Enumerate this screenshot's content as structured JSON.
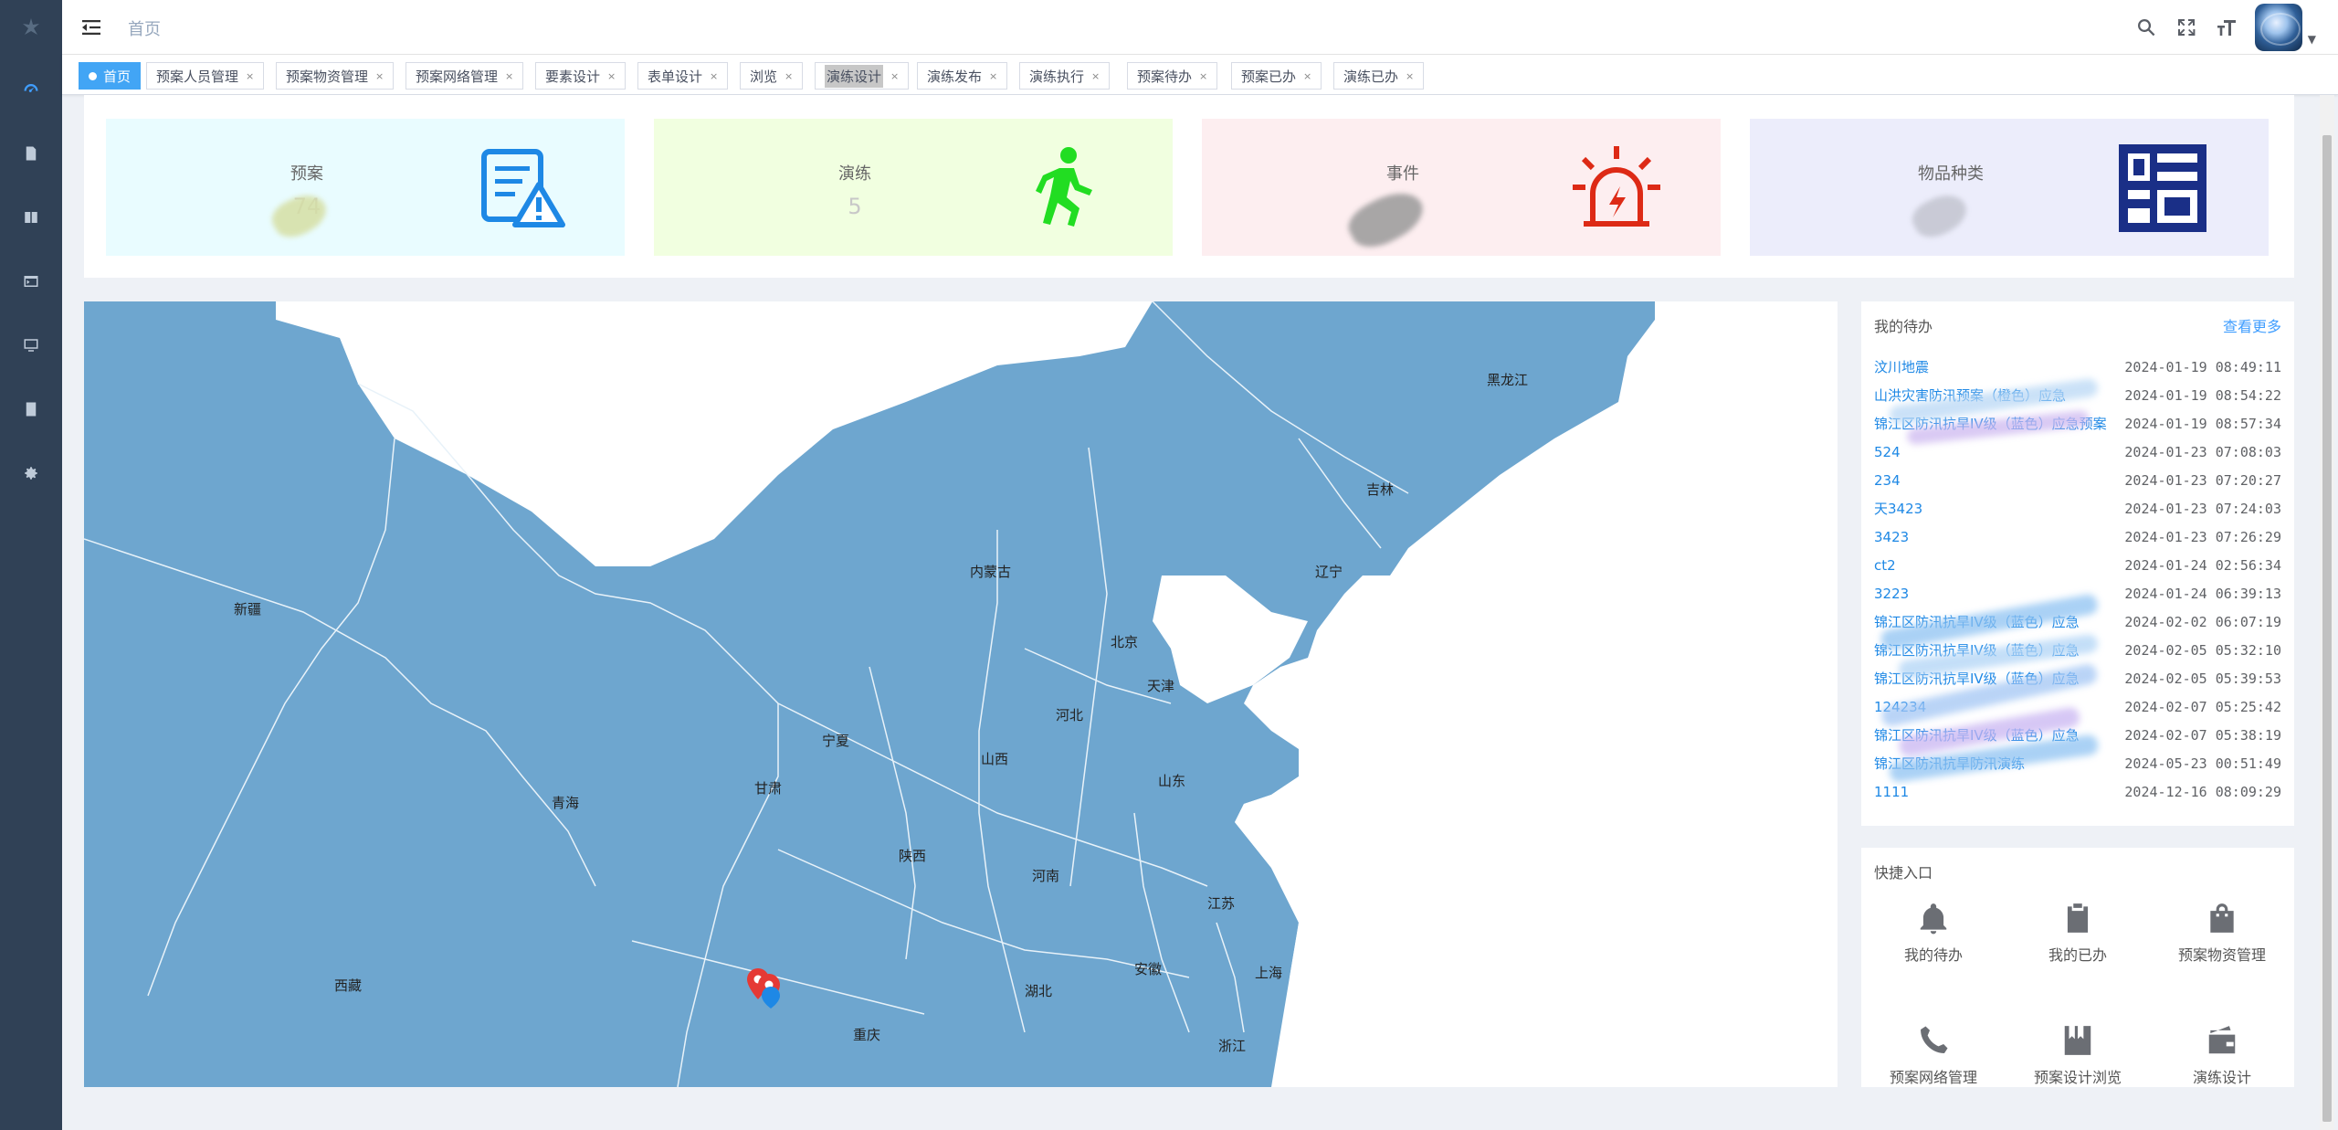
{
  "navbar": {
    "breadcrumb": "首页"
  },
  "tags": [
    {
      "label": "首页",
      "active": true
    },
    {
      "label": "预案人员管理"
    },
    {
      "label": "预案物资管理"
    },
    {
      "label": "预案网络管理"
    },
    {
      "label": "要素设计"
    },
    {
      "label": "表单设计"
    },
    {
      "label": "浏览"
    },
    {
      "label": "演练设计"
    },
    {
      "label": "演练发布"
    },
    {
      "label": "演练执行"
    },
    {
      "label": "预案待办"
    },
    {
      "label": "预案已办"
    },
    {
      "label": "演练已办"
    }
  ],
  "tag_close": "×",
  "stats": [
    {
      "title": "预案",
      "value": "74",
      "bg": "#e9fcff",
      "accent": "#1e88e5"
    },
    {
      "title": "演练",
      "value": "5",
      "bg": "#f1ffe0",
      "accent": "#22dd22"
    },
    {
      "title": "事件",
      "value": "",
      "bg": "#fdeef0",
      "accent": "#dd2a16"
    },
    {
      "title": "物品种类",
      "value": "",
      "bg": "#ecedfb",
      "accent": "#1a2f87"
    }
  ],
  "map": {
    "labels": [
      "黑龙江",
      "吉林",
      "辽宁",
      "内蒙古",
      "新疆",
      "北京",
      "天津",
      "河北",
      "山西",
      "宁夏",
      "甘肃",
      "青海",
      "山东",
      "陕西",
      "河南",
      "江苏",
      "安徽",
      "湖北",
      "西藏",
      "重庆",
      "上海",
      "浙江"
    ]
  },
  "todo": {
    "title": "我的待办",
    "more": "查看更多",
    "items": [
      {
        "name": "汶川地震",
        "time": "2024-01-19 08:49:11"
      },
      {
        "name": "山洪灾害防汛预案（橙色）应急",
        "time": "2024-01-19 08:54:22"
      },
      {
        "name": "锦江区防汛抗旱IV级（蓝色）应急预案",
        "time": "2024-01-19 08:57:34"
      },
      {
        "name": "524",
        "time": "2024-01-23 07:08:03"
      },
      {
        "name": "234",
        "time": "2024-01-23 07:20:27"
      },
      {
        "name": "天3423",
        "time": "2024-01-23 07:24:03"
      },
      {
        "name": "3423",
        "time": "2024-01-23 07:26:29"
      },
      {
        "name": "ct2",
        "time": "2024-01-24 02:56:34"
      },
      {
        "name": "3223",
        "time": "2024-01-24 06:39:13"
      },
      {
        "name": "锦江区防汛抗旱IV级（蓝色）应急",
        "time": "2024-02-02 06:07:19"
      },
      {
        "name": "锦江区防汛抗旱IV级（蓝色）应急",
        "time": "2024-02-05 05:32:10"
      },
      {
        "name": "锦江区防汛抗旱IV级（蓝色）应急",
        "time": "2024-02-05 05:39:53"
      },
      {
        "name": "124234",
        "time": "2024-02-07 05:25:42"
      },
      {
        "name": "锦江区防汛抗旱IV级（蓝色）应急",
        "time": "2024-02-07 05:38:19"
      },
      {
        "name": "锦江区防汛抗旱防汛演练",
        "time": "2024-05-23 00:51:49"
      },
      {
        "name": "1111",
        "time": "2024-12-16 08:09:29"
      }
    ]
  },
  "quick": {
    "title": "快捷入口",
    "items": [
      {
        "label": "我的待办",
        "icon": "bell-icon"
      },
      {
        "label": "我的已办",
        "icon": "clipboard-check-icon"
      },
      {
        "label": "预案物资管理",
        "icon": "shopping-bag-icon"
      },
      {
        "label": "预案网络管理",
        "icon": "phone-icon"
      },
      {
        "label": "预案设计浏览",
        "icon": "bookmarks-icon"
      },
      {
        "label": "演练设计",
        "icon": "wallet-icon"
      }
    ]
  }
}
